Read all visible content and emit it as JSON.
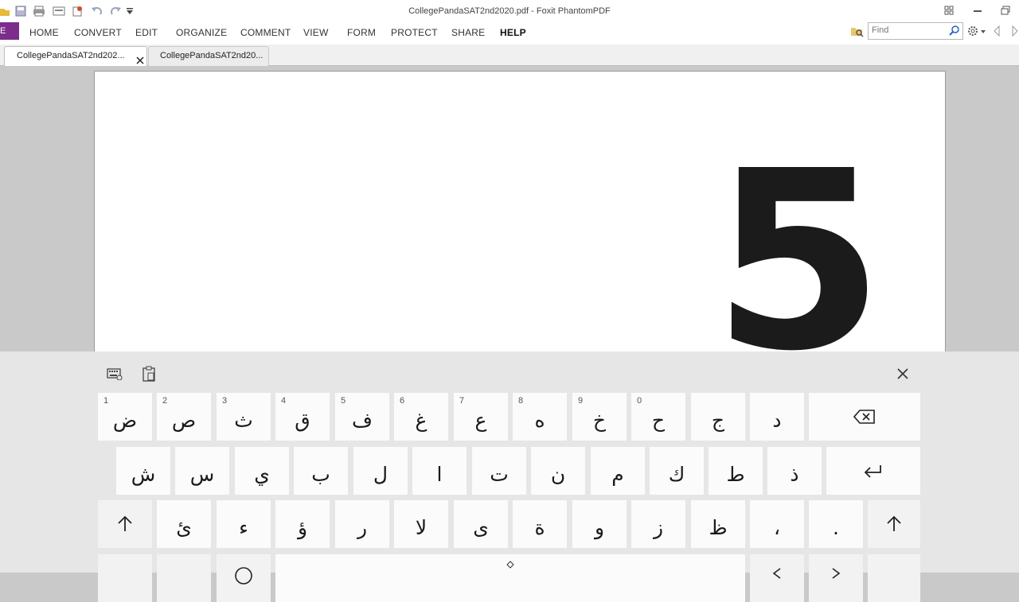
{
  "window": {
    "title": "CollegePandaSAT2nd2020.pdf - Foxit PhantomPDF"
  },
  "ribbon": {
    "file_label": "E",
    "menus": [
      "HOME",
      "CONVERT",
      "EDIT",
      "ORGANIZE",
      "COMMENT",
      "VIEW",
      "FORM",
      "PROTECT",
      "SHARE",
      "HELP"
    ],
    "find_placeholder": "Find"
  },
  "tabs": [
    {
      "label": "CollegePandaSAT2nd202..."
    },
    {
      "label": "CollegePandaSAT2nd20..."
    }
  ],
  "document": {
    "visible_text": "5"
  },
  "keyboard": {
    "row1": [
      {
        "num": "1",
        "char": "ض"
      },
      {
        "num": "2",
        "char": "ص"
      },
      {
        "num": "3",
        "char": "ث"
      },
      {
        "num": "4",
        "char": "ق"
      },
      {
        "num": "5",
        "char": "ف"
      },
      {
        "num": "6",
        "char": "غ"
      },
      {
        "num": "7",
        "char": "ع"
      },
      {
        "num": "8",
        "char": "ه"
      },
      {
        "num": "9",
        "char": "خ"
      },
      {
        "num": "0",
        "char": "ح"
      },
      {
        "num": "",
        "char": "ج"
      },
      {
        "num": "",
        "char": "د"
      }
    ],
    "row2": [
      "ش",
      "س",
      "ي",
      "ب",
      "ل",
      "ا",
      "ت",
      "ن",
      "م",
      "ك",
      "ط",
      "ذ"
    ],
    "row3": [
      "ئ",
      "ء",
      "ؤ",
      "ر",
      "لا",
      "ى",
      "ة",
      "و",
      "ز",
      "ظ",
      "،",
      "."
    ]
  }
}
